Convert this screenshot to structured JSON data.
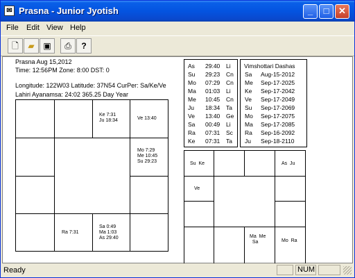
{
  "window": {
    "title": "Prasna - Junior Jyotish"
  },
  "menu": [
    "File",
    "Edit",
    "View",
    "Help"
  ],
  "toolbar": {
    "new": "new-document-icon",
    "open": "open-folder-icon",
    "save": "save-disk-icon",
    "print": "print-icon",
    "help": "help-icon"
  },
  "info": {
    "line1": "Prasna   Aug 15,2012",
    "line2": "Time: 12:56PM  Zone: 8:00   DST: 0",
    "line3": "Longitude: 122W03  Latitude: 37N54  CurPer: Sa/Ke/Ve",
    "line4": "Lahiri Ayanamsa: 24:02  365.25 Day Year"
  },
  "rasi": {
    "gemini": "Ke 7:31\nJu 18:34",
    "cancer": "Ve 13:40",
    "leo": "Mo 7:29\nMe 10:45\nSu 29:23",
    "sagittarius": "Ra 7:31",
    "libra": "Sa 0:49\nMa 1:03\nAs 29:40"
  },
  "positions": [
    [
      "As",
      "29:40",
      "Li"
    ],
    [
      "Su",
      "29:23",
      "Cn"
    ],
    [
      "Mo",
      "07:29",
      "Cn"
    ],
    [
      "Ma",
      "01:03",
      "Li"
    ],
    [
      "Me",
      "10:45",
      "Cn"
    ],
    [
      "Ju",
      "18:34",
      "Ta"
    ],
    [
      "Ve",
      "13:40",
      "Ge"
    ],
    [
      "Sa",
      "00:49",
      "Li"
    ],
    [
      "Ra",
      "07:31",
      "Sc"
    ],
    [
      "Ke",
      "07:31",
      "Ta"
    ]
  ],
  "dashas": {
    "title": "Vimshottari Dashas",
    "rows": [
      [
        "Sa",
        "Aug-15-2012"
      ],
      [
        "Me",
        "Sep-17-2025"
      ],
      [
        "Ke",
        "Sep-17-2042"
      ],
      [
        "Ve",
        "Sep-17-2049"
      ],
      [
        "Su",
        "Sep-17-2069"
      ],
      [
        "Mo",
        "Sep-17-2075"
      ],
      [
        "Ma",
        "Sep-17-2085"
      ],
      [
        "Ra",
        "Sep-16-2092"
      ],
      [
        "Ju",
        "Sep-18-2110"
      ]
    ]
  },
  "navamsa": {
    "pisces": "Su  Ke",
    "gemini": "As  Ju",
    "aquarius": "Ve",
    "libra": "Ma  Me\n  Sa",
    "sagittarius": "Mo  Ra"
  },
  "status": {
    "text": "Ready",
    "num": "NUM"
  }
}
